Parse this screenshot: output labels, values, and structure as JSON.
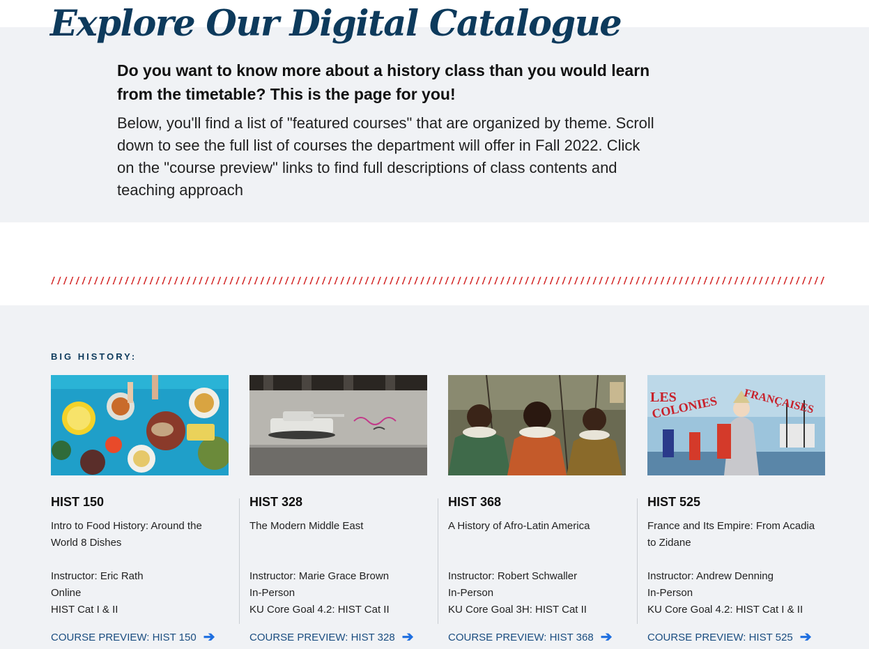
{
  "intro": {
    "title": "Explore Our Digital Catalogue",
    "lead": "Do you want to know more about a history class than you would learn from the timetable? This is the page for you!",
    "body": "Below, you'll find a list of \"featured courses\" that are organized by theme. Scroll down to see the full list of courses the department will offer in Fall 2022. Click on the \"course preview\" links to find full descriptions of class contents and teaching approach"
  },
  "section": {
    "label": "BIG HISTORY:"
  },
  "courses": [
    {
      "code": "HIST 150",
      "title": "Intro to Food History: Around the World 8 Dishes",
      "instructor": "Instructor: Eric Rath",
      "mode": "Online",
      "category": "HIST Cat I & II",
      "preview": "COURSE PREVIEW: HIST 150",
      "image": "food-table-photo"
    },
    {
      "code": "HIST 328",
      "title": "The Modern Middle East",
      "instructor": "Instructor: Marie Grace Brown",
      "mode": "In-Person",
      "category": "KU Core Goal 4.2: HIST Cat II",
      "preview": "COURSE PREVIEW: HIST 328",
      "image": "tank-graffiti-wall-photo"
    },
    {
      "code": "HIST 368",
      "title": "A History of Afro-Latin America",
      "instructor": "Instructor: Robert Schwaller",
      "mode": "In-Person",
      "category": "KU Core Goal 3H: HIST Cat II",
      "preview": "COURSE PREVIEW: HIST 368",
      "image": "three-men-painting"
    },
    {
      "code": "HIST 525",
      "title": "France and Its Empire: From Acadia to Zidane",
      "instructor": "Instructor: Andrew Denning",
      "mode": "In-Person",
      "category": "KU Core Goal 4.2: HIST Cat I & II",
      "preview": "COURSE PREVIEW: HIST 525",
      "image": "colonial-poster",
      "image_text": {
        "les": "LES",
        "colonies": "COLONIES",
        "francaises": "FRANÇAISES"
      }
    }
  ],
  "colors": {
    "navy": "#0d3a5c",
    "link": "#1a4d80",
    "arrow": "#1f6fe0",
    "divider": "#d42b2b",
    "band": "#f0f2f5"
  }
}
